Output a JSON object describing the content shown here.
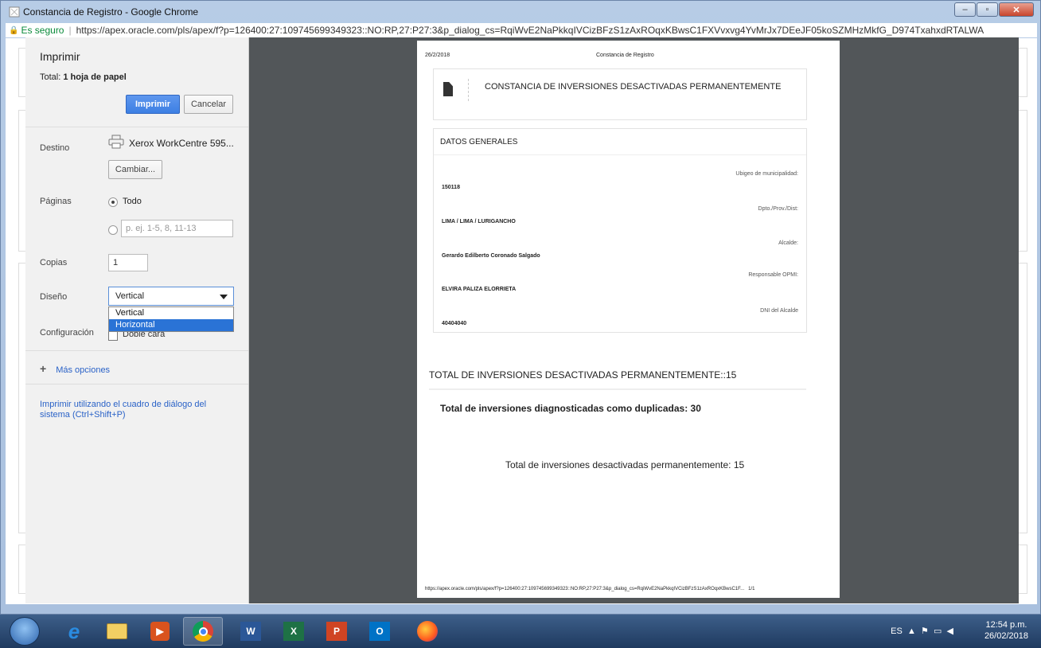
{
  "window": {
    "title": "Constancia de Registro - Google Chrome",
    "min_icon": "minimize-icon",
    "max_icon": "maximize-icon",
    "close_icon": "close-icon"
  },
  "address_bar": {
    "secure_label": "Es seguro",
    "url": "https://apex.oracle.com/pls/apex/f?p=126400:27:109745699349323::NO:RP,27:P27:3&p_dialog_cs=RqiWvE2NaPkkqIVCizBFzS1zAxROqxKBwsC1FXVvxvg4YvMrJx7DEeJF05koSZMHzMkfG_D974TxahxdRTALWA"
  },
  "print_panel": {
    "title": "Imprimir",
    "total_prefix": "Total:",
    "total_value": "1 hoja de papel",
    "print_button": "Imprimir",
    "cancel_button": "Cancelar",
    "destination_label": "Destino",
    "destination_value": "Xerox WorkCentre 595...",
    "change_button": "Cambiar...",
    "pages_label": "Páginas",
    "pages_all": "Todo",
    "pages_placeholder": "p. ej. 1-5, 8, 11-13",
    "copies_label": "Copias",
    "copies_value": "1",
    "layout_label": "Diseño",
    "layout_value": "Vertical",
    "layout_options": [
      "Vertical",
      "Horizontal"
    ],
    "config_label": "Configuración",
    "duplex_label": "Doble cara",
    "more_options": "Más opciones",
    "system_dialog": "Imprimir utilizando el cuadro de diálogo del sistema (Ctrl+Shift+P)"
  },
  "document": {
    "date": "26/2/2018",
    "header_title": "Constancia de Registro",
    "main_title": "CONSTANCIA DE INVERSIONES DESACTIVADAS PERMANENTEMENTE",
    "section_title": "DATOS GENERALES",
    "fields": [
      {
        "label": "Ubigeo de municipalidad:",
        "value": "150118"
      },
      {
        "label": "Dpto./Prov./Dist:",
        "value": "LIMA / LIMA / LURIGANCHO"
      },
      {
        "label": "Alcalde:",
        "value": "Gerardo Edilberto Coronado Salgado"
      },
      {
        "label": "Responsable OPMI:",
        "value": "ELVIRA PALIZA ELORRIETA"
      },
      {
        "label": "DNI del Alcalde",
        "value": "40404040"
      }
    ],
    "total_line": "TOTAL DE INVERSIONES DESACTIVADAS PERMANENTEMENTE::15",
    "duplicates_line": "Total de inversiones diagnosticadas como duplicadas:   30",
    "deactivated_line": "Total de inversiones desactivadas permanentemente: 15",
    "footer_url": "https://apex.oracle.com/pls/apex/f?p=126400:27:109745699349323::NO:RP,27:P27:3&p_dialog_cs=RqiWvE2NaPkkqIVCizBFzS1zAxROqxKBwsC1F...",
    "page_count": "1/1"
  },
  "taskbar": {
    "apps": [
      "ie-icon",
      "file-explorer-icon",
      "media-player-icon",
      "chrome-icon",
      "word-icon",
      "excel-icon",
      "powerpoint-icon",
      "outlook-icon",
      "firefox-icon"
    ],
    "language": "ES",
    "time": "12:54 p.m.",
    "date": "26/02/2018"
  }
}
